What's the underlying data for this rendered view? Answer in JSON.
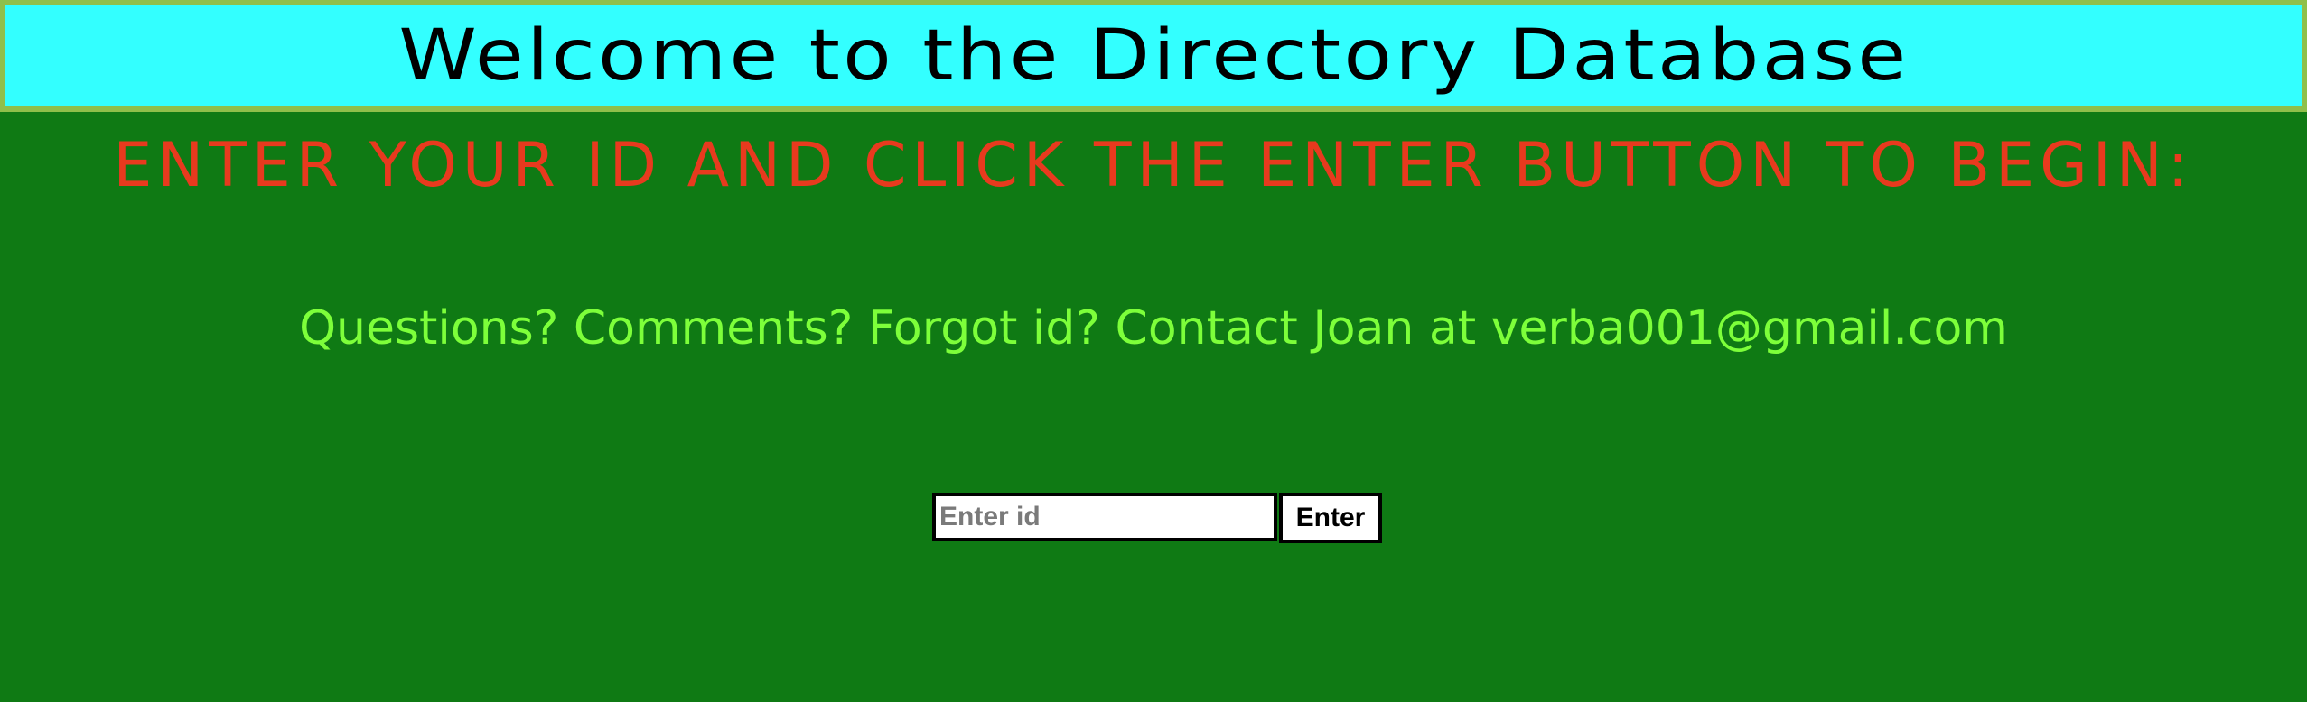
{
  "header": {
    "title": "Welcome to the Directory Database"
  },
  "instructions": {
    "text": "Enter your ID and click the Enter button to begin:"
  },
  "contact": {
    "text": "Questions? Comments? Forgot id? Contact Joan at verba001@gmail.com"
  },
  "login": {
    "id_placeholder": "Enter id",
    "id_value": "",
    "enter_label": "Enter"
  },
  "colors": {
    "background": "#0f7a14",
    "header_background": "#33ffff",
    "header_border": "#8fbf4a",
    "instructions_text": "#e83a1e",
    "contact_text": "#7dff3a"
  }
}
